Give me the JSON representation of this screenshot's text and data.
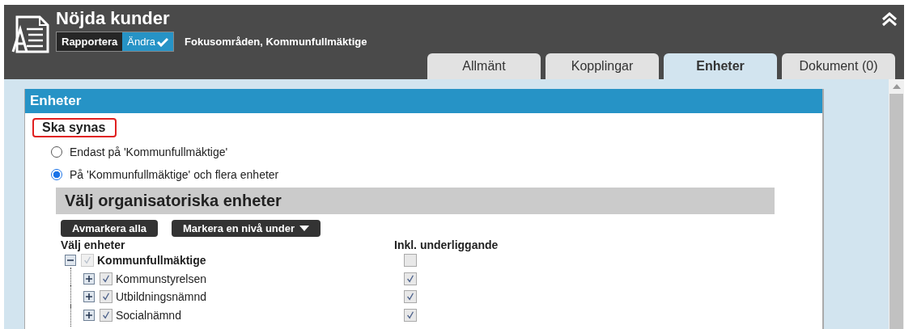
{
  "header": {
    "title": "Nöjda kunder",
    "breadcrumb": "Fokusområden, Kommunfullmäktige",
    "modes": [
      {
        "label": "Rapportera",
        "selected": false
      },
      {
        "label": "Ändra",
        "selected": true
      }
    ]
  },
  "tabs": [
    {
      "label": "Allmänt",
      "selected": false
    },
    {
      "label": "Kopplingar",
      "selected": false
    },
    {
      "label": "Enheter",
      "selected": true
    },
    {
      "label": "Dokument (0)",
      "selected": false
    }
  ],
  "panel": {
    "title": "Enheter",
    "section_label": "Ska synas",
    "visibility_options": [
      {
        "label": "Endast på 'Kommunfullmäktige'",
        "selected": false
      },
      {
        "label": "På 'Kommunfullmäktige' och flera enheter",
        "selected": true
      }
    ],
    "org_units": {
      "title": "Välj organisatoriska enheter",
      "buttons": [
        {
          "label": "Avmarkera alla",
          "kind": "plain"
        },
        {
          "label": "Markera en nivå under",
          "kind": "dropdown"
        }
      ],
      "columns": [
        "Välj enheter",
        "Inkl. underliggande"
      ],
      "tree": [
        {
          "label": "Kommunfullmäktige",
          "expanded": true,
          "checked": true,
          "disabled": true,
          "include_sub": false,
          "children": [
            {
              "label": "Kommunstyrelsen",
              "expanded": false,
              "checked": true,
              "disabled": false,
              "include_sub": true
            },
            {
              "label": "Utbildningsnämnd",
              "expanded": false,
              "checked": true,
              "disabled": false,
              "include_sub": true
            },
            {
              "label": "Socialnämnd",
              "expanded": false,
              "checked": true,
              "disabled": false,
              "include_sub": true
            }
          ]
        }
      ]
    }
  }
}
